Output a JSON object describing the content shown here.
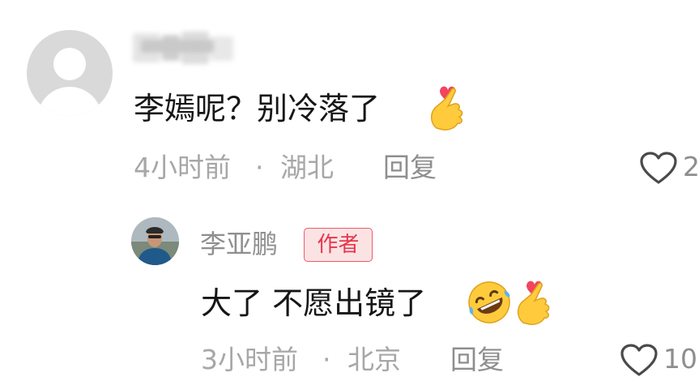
{
  "comments": [
    {
      "text": "李嫣呢？别冷落了",
      "time": "4小时前",
      "location": "湖北",
      "reply_label": "回复",
      "likes": "2",
      "emoji": "finger-heart"
    },
    {
      "author_name": "李亚鹏",
      "badge": "作者",
      "text": "大了 不愿出镜了",
      "time": "3小时前",
      "location": "北京",
      "reply_label": "回复",
      "likes": "10",
      "emoji": [
        "rolling-on-floor-laughing",
        "finger-heart"
      ]
    }
  ],
  "separator": "·",
  "colors": {
    "text": "#161616",
    "meta": "#a7a7a7",
    "badge_text": "#e8364c",
    "badge_bg": "#fbe3e4",
    "avatar_placeholder": "#d9d9d9"
  }
}
